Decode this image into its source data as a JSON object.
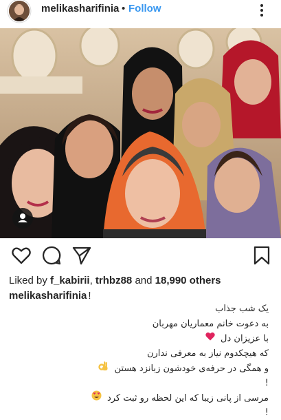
{
  "post": {
    "username": "melikasharifinia",
    "separator": "•",
    "follow_label": "Follow"
  },
  "icons": {
    "more": "more-vertical-icon",
    "like": "heart-outline-icon",
    "comment": "comment-bubble-icon",
    "share": "paper-plane-icon",
    "save": "bookmark-outline-icon",
    "tagged": "person-tag-icon"
  },
  "likes": {
    "prefix": "Liked by",
    "user1": "f_kabirii",
    "sep": ",",
    "user2": "trhbz88",
    "conj": "and",
    "count": "18,990 others"
  },
  "caption": {
    "username": "melikasharifinia",
    "user_suffix": "!",
    "lines": [
      "یک شب جذاب",
      "به دعوت خانم معماریان مهربان",
      "با عزیزان دل",
      "که هیچکدوم نیاز به معرفی ندارن",
      "و همگی در حرفه‌ی خودشون زبانزد هستن",
      "!",
      "مرسی از پانی زیبا که این لحظه رو ثبت کرد",
      "!"
    ]
  },
  "colors": {
    "link_blue": "#3897f0",
    "text": "#262626",
    "heart_red": "#e0245e",
    "ok_hand": "#f5c242"
  }
}
